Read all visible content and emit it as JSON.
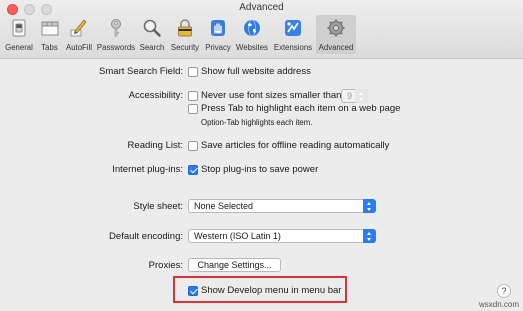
{
  "window": {
    "title": "Advanced"
  },
  "toolbar": {
    "tabs": [
      {
        "label": "General",
        "icon": "general-switch-icon"
      },
      {
        "label": "Tabs",
        "icon": "tabs-icon"
      },
      {
        "label": "AutoFill",
        "icon": "pencil-icon"
      },
      {
        "label": "Passwords",
        "icon": "key-icon"
      },
      {
        "label": "Search",
        "icon": "magnifier-icon"
      },
      {
        "label": "Security",
        "icon": "lock-icon"
      },
      {
        "label": "Privacy",
        "icon": "hand-icon"
      },
      {
        "label": "Websites",
        "icon": "globe-icon"
      },
      {
        "label": "Extensions",
        "icon": "puzzle-icon"
      },
      {
        "label": "Advanced",
        "icon": "gear-icon",
        "selected": true
      }
    ]
  },
  "settings": {
    "smart_search": {
      "label": "Smart Search Field:",
      "option": "Show full website address",
      "checked": false
    },
    "accessibility": {
      "label": "Accessibility:",
      "font_option": "Never use font sizes smaller than",
      "font_value": "9",
      "font_checked": false,
      "tab_option": "Press Tab to highlight each item on a web page",
      "tab_checked": false,
      "tab_hint": "Option-Tab highlights each item."
    },
    "reading_list": {
      "label": "Reading List:",
      "option": "Save articles for offline reading automatically",
      "checked": false
    },
    "plugins": {
      "label": "Internet plug-ins:",
      "option": "Stop plug-ins to save power",
      "checked": true
    },
    "style_sheet": {
      "label": "Style sheet:",
      "value": "None Selected"
    },
    "encoding": {
      "label": "Default encoding:",
      "value": "Western (ISO Latin 1)"
    },
    "proxies": {
      "label": "Proxies:",
      "button": "Change Settings..."
    },
    "develop": {
      "option": "Show Develop menu in menu bar",
      "checked": true
    }
  },
  "help": {
    "label": "?"
  },
  "watermark": {
    "text": "wsxdn.com"
  },
  "colors": {
    "accent": "#2a7cf1",
    "highlight_box": "#d8323a"
  }
}
